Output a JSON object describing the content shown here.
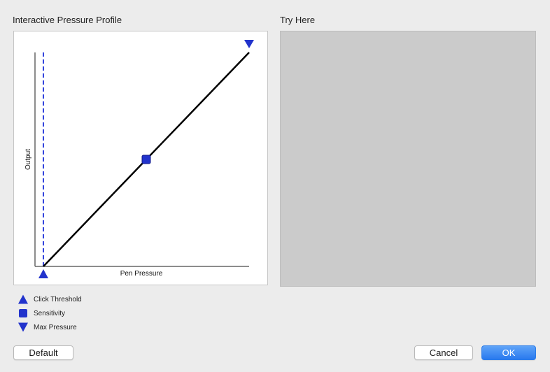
{
  "profile": {
    "title": "Interactive Pressure Profile",
    "xlabel": "Pen Pressure",
    "ylabel": "Output",
    "click_threshold": 0.0,
    "sensitivity": [
      0.5,
      0.5
    ],
    "max_pressure": 1.0
  },
  "try_here": {
    "title": "Try Here"
  },
  "legend": [
    {
      "label": "Click Threshold",
      "icon": "triangle-up-icon"
    },
    {
      "label": "Sensitivity",
      "icon": "square-icon"
    },
    {
      "label": "Max Pressure",
      "icon": "triangle-down-icon"
    }
  ],
  "buttons": {
    "default_label": "Default",
    "cancel_label": "Cancel",
    "ok_label": "OK"
  },
  "colors": {
    "marker": "#2233cc",
    "threshold_line": "#3344dd",
    "curve": "#000000",
    "accent": "#2979ee"
  }
}
